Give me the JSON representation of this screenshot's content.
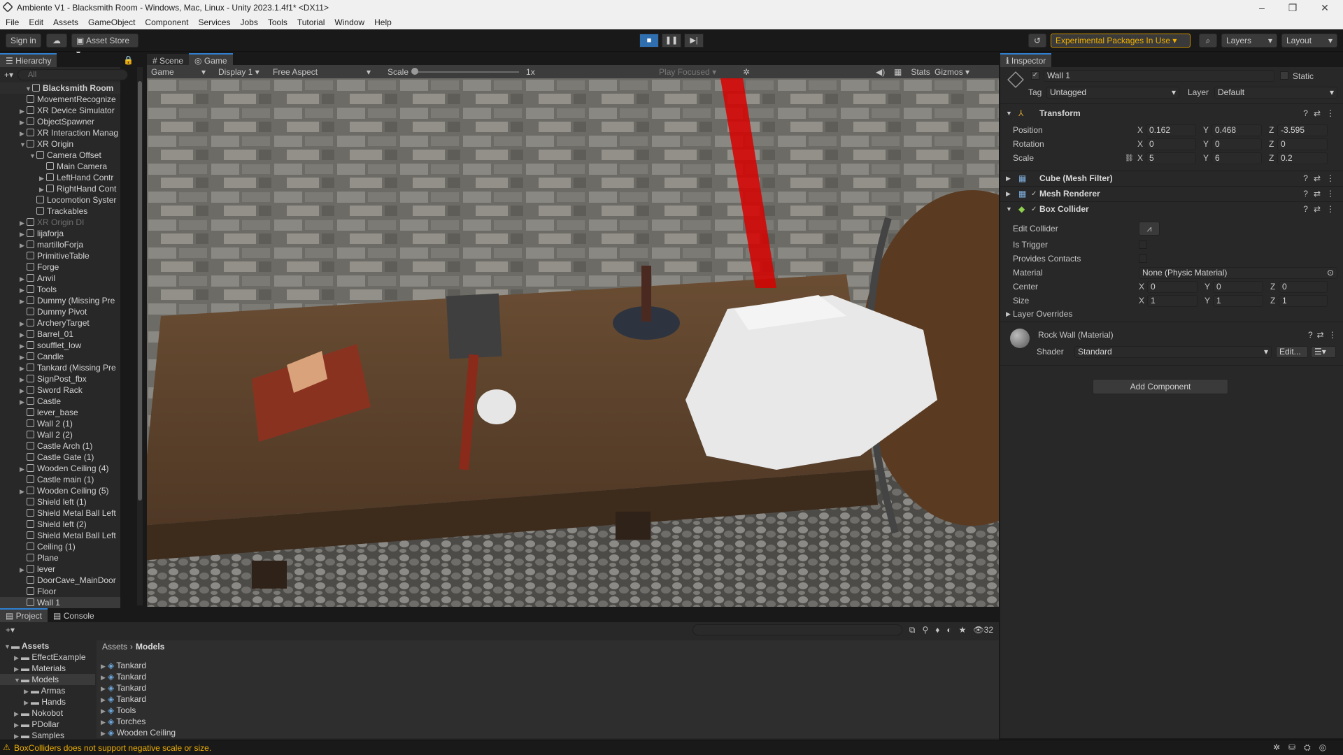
{
  "title_bar": {
    "text": "Ambiente V1 - Blacksmith Room - Windows, Mac, Linux - Unity 2023.1.4f1* <DX11>"
  },
  "menu": [
    "File",
    "Edit",
    "Assets",
    "GameObject",
    "Component",
    "Services",
    "Jobs",
    "Tools",
    "Tutorial",
    "Window",
    "Help"
  ],
  "toolbar": {
    "sign_in": "Sign in",
    "asset_store": "Asset Store",
    "experimental": "Experimental Packages In Use",
    "layers": "Layers",
    "layout": "Layout"
  },
  "hierarchy": {
    "tab": "Hierarchy",
    "search_placeholder": "All",
    "root": "Blacksmith Room",
    "items": [
      {
        "label": "MovementRecognize",
        "depth": 1,
        "arrow": "",
        "dim": false
      },
      {
        "label": "XR Device Simulator",
        "depth": 1,
        "arrow": "▶",
        "dim": false
      },
      {
        "label": "ObjectSpawner",
        "depth": 1,
        "arrow": "▶",
        "dim": false
      },
      {
        "label": "XR Interaction Manag",
        "depth": 1,
        "arrow": "▶",
        "dim": false
      },
      {
        "label": "XR Origin",
        "depth": 1,
        "arrow": "▼",
        "dim": false
      },
      {
        "label": "Camera Offset",
        "depth": 2,
        "arrow": "▼",
        "dim": false
      },
      {
        "label": "Main Camera",
        "depth": 3,
        "arrow": "",
        "dim": false
      },
      {
        "label": "LeftHand Contr",
        "depth": 3,
        "arrow": "▶",
        "dim": false
      },
      {
        "label": "RightHand Cont",
        "depth": 3,
        "arrow": "▶",
        "dim": false
      },
      {
        "label": "Locomotion Syster",
        "depth": 2,
        "arrow": "",
        "dim": false
      },
      {
        "label": "Trackables",
        "depth": 2,
        "arrow": "",
        "dim": false
      },
      {
        "label": "XR Origin DI",
        "depth": 1,
        "arrow": "▶",
        "dim": true
      },
      {
        "label": "lijaforja",
        "depth": 1,
        "arrow": "▶",
        "dim": false
      },
      {
        "label": "martilloForja",
        "depth": 1,
        "arrow": "▶",
        "dim": false
      },
      {
        "label": "PrimitiveTable",
        "depth": 1,
        "arrow": "",
        "dim": false
      },
      {
        "label": "Forge",
        "depth": 1,
        "arrow": "",
        "dim": false
      },
      {
        "label": "Anvil",
        "depth": 1,
        "arrow": "▶",
        "dim": false
      },
      {
        "label": "Tools",
        "depth": 1,
        "arrow": "▶",
        "dim": false
      },
      {
        "label": "Dummy (Missing Pre",
        "depth": 1,
        "arrow": "▶",
        "dim": false
      },
      {
        "label": "Dummy Pivot",
        "depth": 1,
        "arrow": "",
        "dim": false
      },
      {
        "label": "ArcheryTarget",
        "depth": 1,
        "arrow": "▶",
        "dim": false
      },
      {
        "label": "Barrel_01",
        "depth": 1,
        "arrow": "▶",
        "dim": false
      },
      {
        "label": "soufflet_low",
        "depth": 1,
        "arrow": "▶",
        "dim": false
      },
      {
        "label": "Candle",
        "depth": 1,
        "arrow": "▶",
        "dim": false
      },
      {
        "label": "Tankard (Missing Pre",
        "depth": 1,
        "arrow": "▶",
        "dim": false
      },
      {
        "label": "SignPost_fbx",
        "depth": 1,
        "arrow": "▶",
        "dim": false
      },
      {
        "label": "Sword Rack",
        "depth": 1,
        "arrow": "▶",
        "dim": false
      },
      {
        "label": "Castle",
        "depth": 1,
        "arrow": "▶",
        "dim": false
      },
      {
        "label": "lever_base",
        "depth": 1,
        "arrow": "",
        "dim": false
      },
      {
        "label": "Wall 2 (1)",
        "depth": 1,
        "arrow": "",
        "dim": false
      },
      {
        "label": "Wall 2 (2)",
        "depth": 1,
        "arrow": "",
        "dim": false
      },
      {
        "label": "Castle Arch (1)",
        "depth": 1,
        "arrow": "",
        "dim": false
      },
      {
        "label": "Castle Gate (1)",
        "depth": 1,
        "arrow": "",
        "dim": false
      },
      {
        "label": "Wooden Ceiling (4)",
        "depth": 1,
        "arrow": "▶",
        "dim": false
      },
      {
        "label": "Castle main (1)",
        "depth": 1,
        "arrow": "",
        "dim": false
      },
      {
        "label": "Wooden Ceiling (5)",
        "depth": 1,
        "arrow": "▶",
        "dim": false
      },
      {
        "label": "Shield left (1)",
        "depth": 1,
        "arrow": "",
        "dim": false
      },
      {
        "label": "Shield Metal Ball Left",
        "depth": 1,
        "arrow": "",
        "dim": false
      },
      {
        "label": "Shield left (2)",
        "depth": 1,
        "arrow": "",
        "dim": false
      },
      {
        "label": "Shield Metal Ball Left",
        "depth": 1,
        "arrow": "",
        "dim": false
      },
      {
        "label": "Ceiling (1)",
        "depth": 1,
        "arrow": "",
        "dim": false
      },
      {
        "label": "Plane",
        "depth": 1,
        "arrow": "",
        "dim": false
      },
      {
        "label": "lever",
        "depth": 1,
        "arrow": "▶",
        "dim": false
      },
      {
        "label": "DoorCave_MainDoor",
        "depth": 1,
        "arrow": "",
        "dim": false
      },
      {
        "label": "Floor",
        "depth": 1,
        "arrow": "",
        "dim": false
      },
      {
        "label": "Wall 1",
        "depth": 1,
        "arrow": "",
        "dim": false
      }
    ]
  },
  "views": {
    "scene_tab": "Scene",
    "game_tab": "Game",
    "game_dropdown": "Game",
    "display": "Display 1",
    "aspect": "Free Aspect",
    "scale_label": "Scale",
    "scale_value": "1x",
    "play_focused": "Play Focused",
    "stats": "Stats",
    "gizmos": "Gizmos"
  },
  "inspector": {
    "tab": "Inspector",
    "object_name": "Wall 1",
    "static_label": "Static",
    "tag_label": "Tag",
    "tag_value": "Untagged",
    "layer_label": "Layer",
    "layer_value": "Default",
    "transform": {
      "title": "Transform",
      "position": {
        "label": "Position",
        "x": "0.162",
        "y": "0.468",
        "z": "-3.595"
      },
      "rotation": {
        "label": "Rotation",
        "x": "0",
        "y": "0",
        "z": "0"
      },
      "scale": {
        "label": "Scale",
        "x": "5",
        "y": "6",
        "z": "0.2"
      }
    },
    "mesh_filter": "Cube (Mesh Filter)",
    "mesh_renderer": "Mesh Renderer",
    "box_collider": {
      "title": "Box Collider",
      "edit_collider": "Edit Collider",
      "is_trigger": "Is Trigger",
      "provides_contacts": "Provides Contacts",
      "material_label": "Material",
      "material_value": "None (Physic Material)",
      "center": {
        "label": "Center",
        "x": "0",
        "y": "0",
        "z": "0"
      },
      "size": {
        "label": "Size",
        "x": "1",
        "y": "1",
        "z": "1"
      },
      "layer_overrides": "Layer Overrides"
    },
    "material": {
      "name": "Rock Wall (Material)",
      "shader_label": "Shader",
      "shader_value": "Standard",
      "edit": "Edit..."
    },
    "add_component": "Add Component",
    "axis": {
      "x": "X",
      "y": "Y",
      "z": "Z"
    }
  },
  "project": {
    "project_tab": "Project",
    "console_tab": "Console",
    "breadcrumb": [
      "Assets",
      "Models"
    ],
    "tree": [
      {
        "label": "Assets",
        "depth": 0,
        "arrow": "▼",
        "bold": true
      },
      {
        "label": "EffectExample",
        "depth": 1,
        "arrow": "▶",
        "bold": false
      },
      {
        "label": "Materials",
        "depth": 1,
        "arrow": "▶",
        "bold": false
      },
      {
        "label": "Models",
        "depth": 1,
        "arrow": "▼",
        "bold": false
      },
      {
        "label": "Armas",
        "depth": 2,
        "arrow": "▶",
        "bold": false
      },
      {
        "label": "Hands",
        "depth": 2,
        "arrow": "▶",
        "bold": false
      },
      {
        "label": "Nokobot",
        "depth": 1,
        "arrow": "▶",
        "bold": false
      },
      {
        "label": "PDollar",
        "depth": 1,
        "arrow": "▶",
        "bold": false
      },
      {
        "label": "Samples",
        "depth": 1,
        "arrow": "▶",
        "bold": false
      }
    ],
    "files": [
      "Tankard",
      "Tankard",
      "Tankard",
      "Tankard",
      "Tools",
      "Torches",
      "Wooden Ceiling"
    ],
    "hidden_count": "32"
  },
  "status": {
    "message": "BoxColliders does not support negative scale or size."
  },
  "colors": {
    "accent": "#2f7fd0",
    "warning": "#f0b000",
    "panel": "#282828",
    "experimental_border": "#c99000"
  }
}
